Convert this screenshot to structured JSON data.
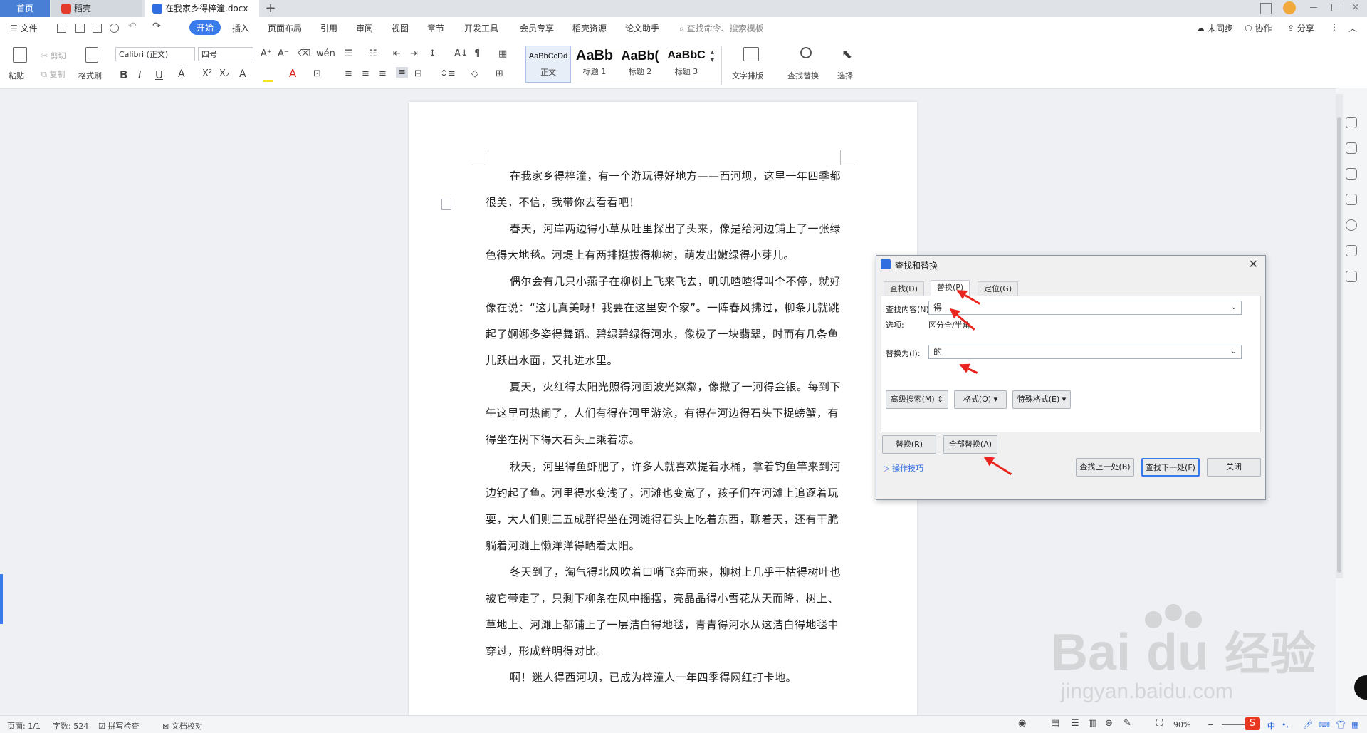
{
  "tabs": {
    "home": "首页",
    "doke": "稻壳",
    "doc": "在我家乡得梓潼.docx",
    "new": "+"
  },
  "menu": {
    "file": "文件",
    "items": [
      "开始",
      "插入",
      "页面布局",
      "引用",
      "审阅",
      "视图",
      "章节",
      "开发工具",
      "会员专享",
      "稻壳资源",
      "论文助手"
    ],
    "search_placeholder": "查找命令、搜索模板",
    "sync": "未同步",
    "collab": "协作",
    "share": "分享"
  },
  "toolbar": {
    "paste": "粘贴",
    "cut": "剪切",
    "copy": "复制",
    "format_painter": "格式刷",
    "font_name": "Calibri (正文)",
    "font_size": "四号",
    "bold": "B",
    "italic": "I",
    "underline": "U",
    "styles": [
      {
        "sample": "AaBbCcDd",
        "name": "正文"
      },
      {
        "sample": "AaBb",
        "name": "标题 1"
      },
      {
        "sample": "AaBb(",
        "name": "标题 2"
      },
      {
        "sample": "AaBbC",
        "name": "标题 3"
      }
    ],
    "text_layout": "文字排版",
    "find_replace": "查找替换",
    "select": "选择"
  },
  "document": {
    "paragraphs": [
      "在我家乡得梓潼，有一个游玩得好地方——西河坝，这里一年四季都很美，不信，我带你去看看吧！",
      "春天，河岸两边得小草从吐里探出了头来，像是给河边铺上了一张绿色得大地毯。河堤上有两排挺拔得柳树，萌发出嫩绿得小芽儿。",
      "偶尔会有几只小燕子在柳树上飞来飞去，叽叽喳喳得叫个不停，就好像在说：“这儿真美呀！我要在这里安个家”。一阵春风拂过，柳条儿就跳起了婀娜多姿得舞蹈。碧绿碧绿得河水，像极了一块翡翠，时而有几条鱼儿跃出水面，又扎进水里。",
      "夏天，火红得太阳光照得河面波光粼粼，像撒了一河得金银。每到下午这里可热闹了，人们有得在河里游泳，有得在河边得石头下捉螃蟹，有得坐在树下得大石头上乘着凉。",
      "秋天，河里得鱼虾肥了，许多人就喜欢提着水桶，拿着钓鱼竿来到河边钓起了鱼。河里得水变浅了，河滩也变宽了，孩子们在河滩上追逐着玩耍，大人们则三五成群得坐在河滩得石头上吃着东西，聊着天，还有干脆躺着河滩上懒洋洋得晒着太阳。",
      "冬天到了，淘气得北风吹着口哨飞奔而来，柳树上几乎干枯得树叶也被它带走了，只剩下柳条在风中摇摆，亮晶晶得小雪花从天而降，树上、草地上、河滩上都铺上了一层洁白得地毯，青青得河水从这洁白得地毯中穿过，形成鲜明得对比。",
      "啊！迷人得西河坝，已成为梓潼人一年四季得网红打卡地。"
    ]
  },
  "dialog": {
    "title": "查找和替换",
    "tabs": [
      "查找(D)",
      "替换(P)",
      "定位(G)"
    ],
    "find_label": "查找内容(N):",
    "find_value": "得",
    "options_label": "选项:",
    "options_value": "区分全/半角",
    "replace_label": "替换为(I):",
    "replace_value": "的",
    "advanced": "高级搜索(M)",
    "format": "格式(O)",
    "special": "特殊格式(E)",
    "replace_btn": "替换(R)",
    "replace_all_btn": "全部替换(A)",
    "tips": "操作技巧",
    "find_prev": "查找上一处(B)",
    "find_next": "查找下一处(F)",
    "close": "关闭",
    "accent": "#e8251f"
  },
  "status": {
    "page": "页面: 1/1",
    "words": "字数: 524",
    "spell": "拼写检查",
    "proof": "文档校对",
    "zoom": "90%",
    "ime": "中"
  },
  "watermark": {
    "brand": "Bai",
    "brand2": "经验",
    "url": "jingyan.baidu.com"
  }
}
